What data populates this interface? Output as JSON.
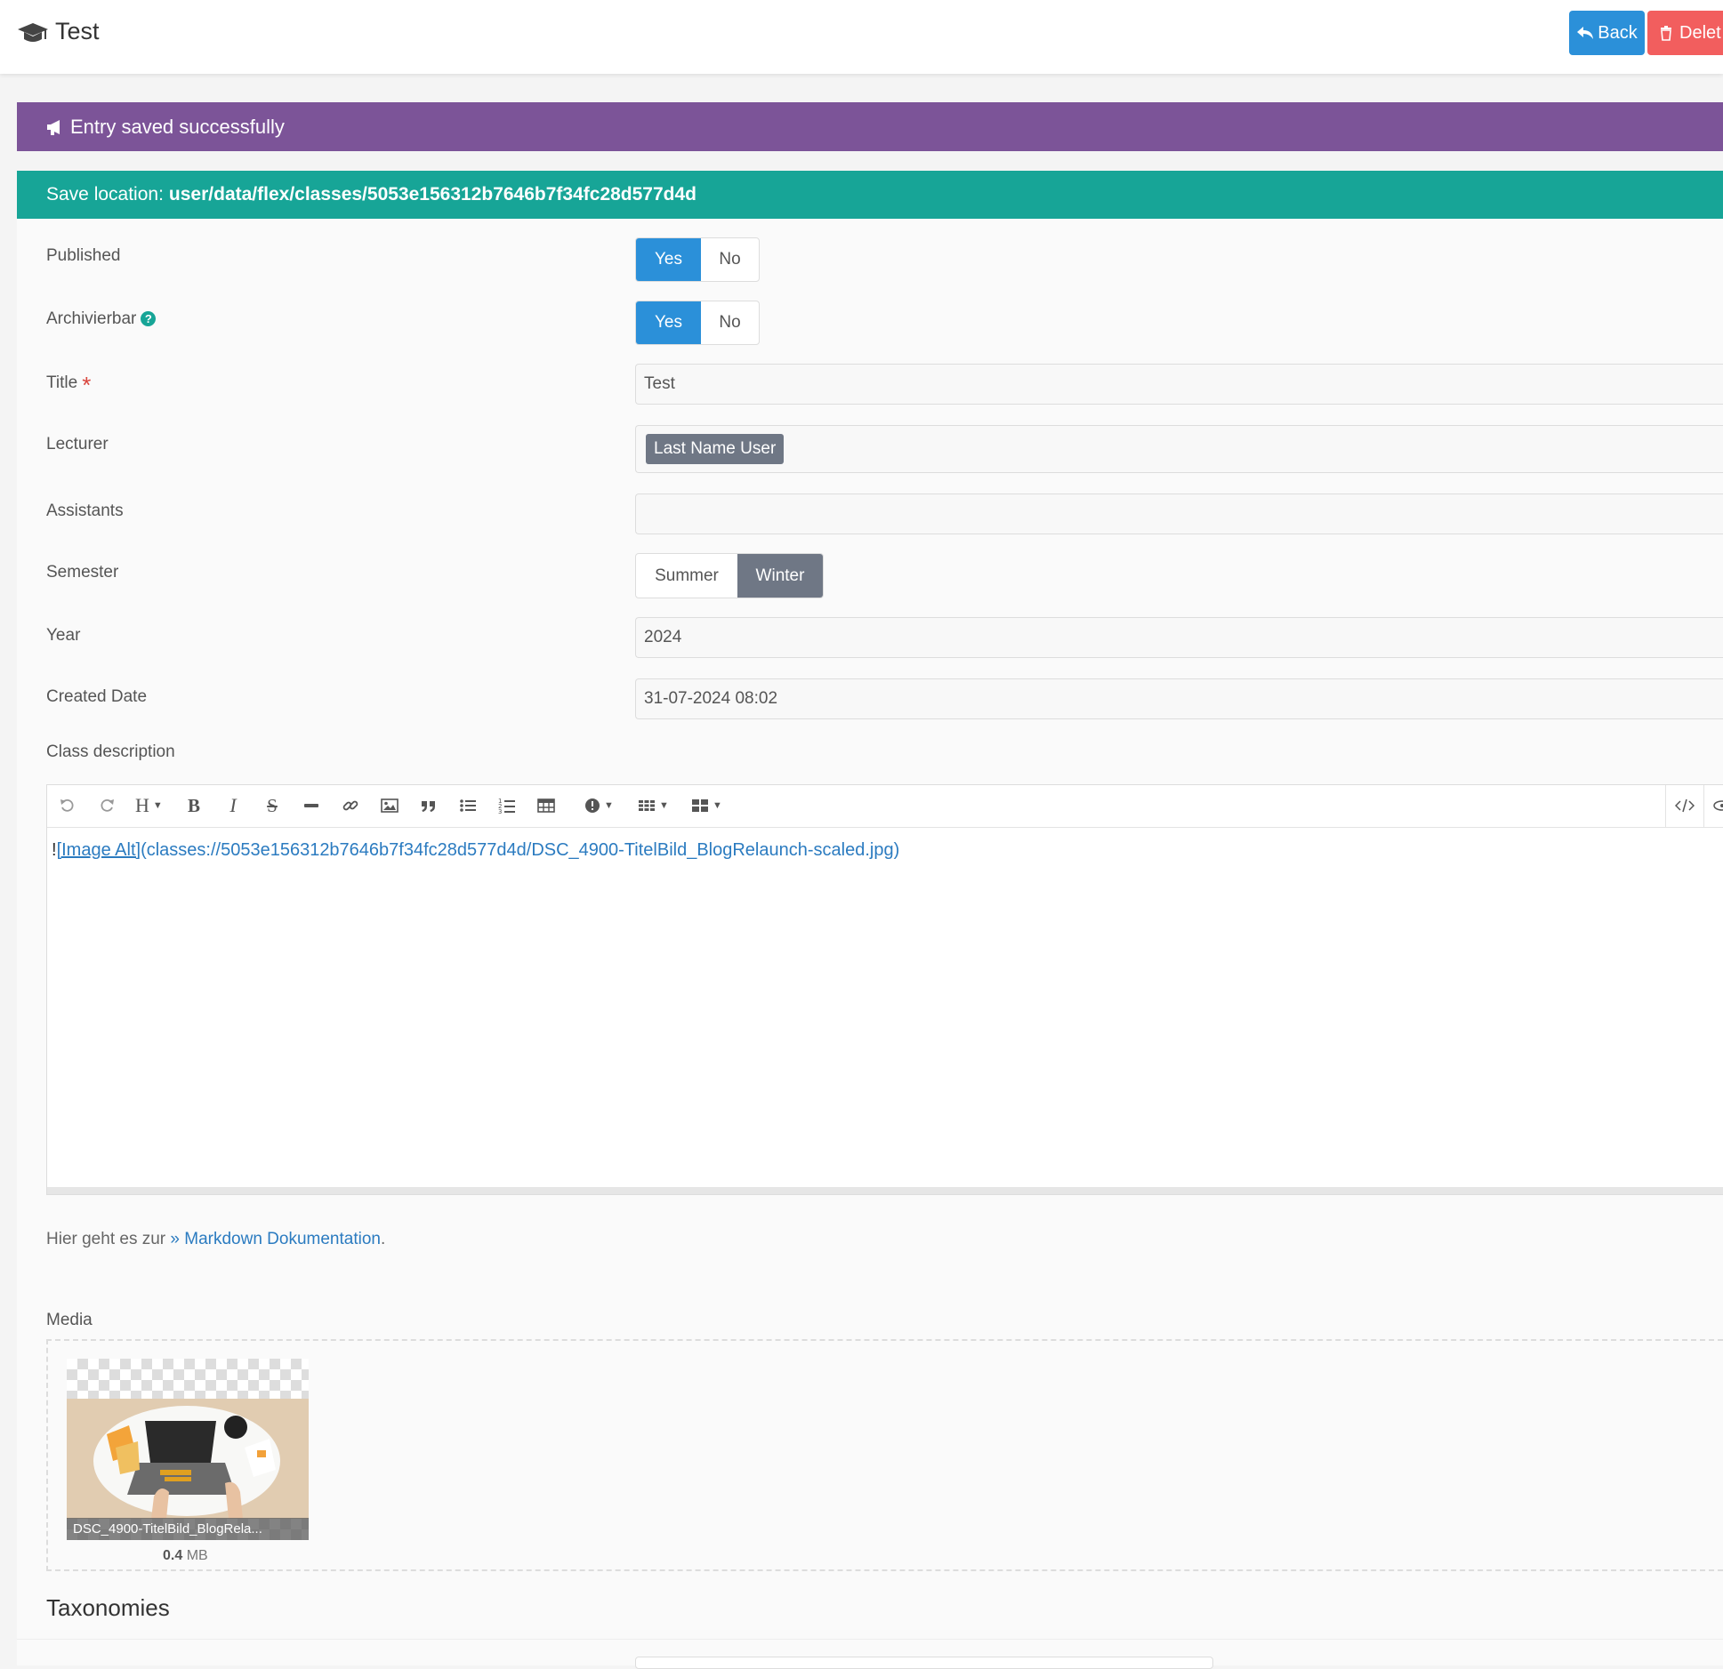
{
  "header": {
    "title": "Test",
    "back_label": "Back",
    "delete_label": "Delet"
  },
  "alerts": {
    "saved": "Entry saved successfully",
    "location_label": "Save location:",
    "location_path": "user/data/flex/classes/5053e156312b7646b7f34fc28d577d4d"
  },
  "form": {
    "published": {
      "label": "Published",
      "yes": "Yes",
      "no": "No",
      "selected": "Yes"
    },
    "archivierbar": {
      "label": "Archivierbar",
      "help": "?",
      "yes": "Yes",
      "no": "No",
      "selected": "Yes"
    },
    "title": {
      "label": "Title",
      "required_mark": "*",
      "value": "Test"
    },
    "lecturer": {
      "label": "Lecturer",
      "tag": "Last Name User"
    },
    "assistants": {
      "label": "Assistants",
      "value": ""
    },
    "semester": {
      "label": "Semester",
      "options": [
        "Summer",
        "Winter"
      ],
      "selected": "Winter"
    },
    "year": {
      "label": "Year",
      "value": "2024"
    },
    "created_date": {
      "label": "Created Date",
      "value": "31-07-2024 08:02"
    },
    "class_description": {
      "label": "Class description",
      "content_bang": "!",
      "content_alt": "[Image Alt]",
      "content_url": "(classes://5053e156312b7646b7f34fc28d577d4d/DSC_4900-TitelBild_BlogRelaunch-scaled.jpg)"
    },
    "hint": {
      "text": "Hier geht es zur",
      "link": "» Markdown Dokumentation",
      "end": "."
    },
    "media": {
      "label": "Media",
      "file_name": "DSC_4900-TitelBild_BlogRela...",
      "file_size_value": "0.4",
      "file_size_unit": "MB"
    }
  },
  "taxonomies": {
    "title": "Taxonomies"
  },
  "toolbar_icons": [
    "undo-icon",
    "redo-icon",
    "heading-icon",
    "bold-icon",
    "italic-icon",
    "strikethrough-icon",
    "horizontal-rule-icon",
    "link-icon",
    "image-icon",
    "quote-icon",
    "bullet-list-icon",
    "numbered-list-icon",
    "table-icon",
    "notice-icon",
    "columns-icon",
    "grid-icon",
    "code-view-icon",
    "preview-icon"
  ],
  "colors": {
    "primary": "#2b90d9",
    "danger": "#f25e5e",
    "alert_purple": "#7c5498",
    "alert_teal": "#17a597",
    "toggle_gray": "#6f7785"
  }
}
